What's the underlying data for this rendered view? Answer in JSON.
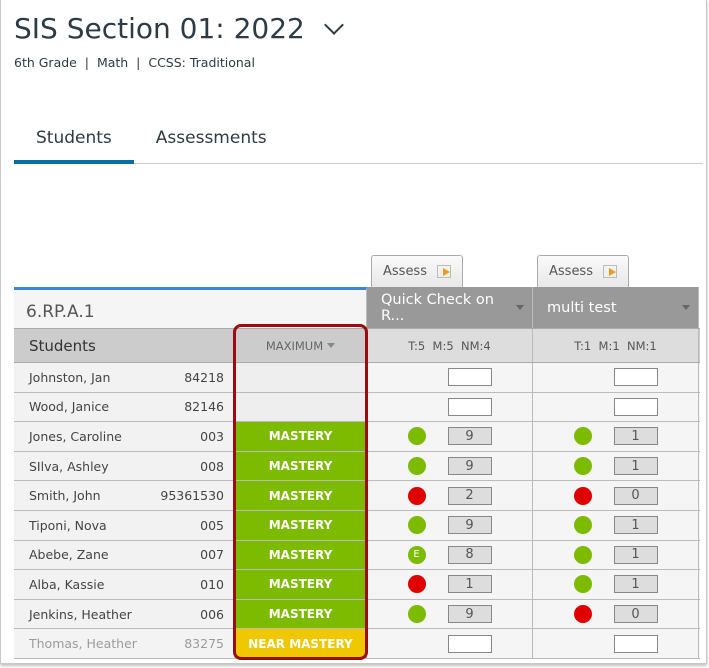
{
  "header": {
    "title": "SIS Section 01: 2022",
    "subtitle": "6th Grade  |  Math  |  CCSS: Traditional"
  },
  "tabs": [
    {
      "label": "Students",
      "active": true
    },
    {
      "label": "Assessments",
      "active": false
    }
  ],
  "standard": "6.RP.A.1",
  "assess_label": "Assess",
  "columns": {
    "students": "Students",
    "calc": "MAXIMUM",
    "assessments": [
      {
        "name": "Quick Check on R...",
        "stats": "T:5  M:5  NM:4"
      },
      {
        "name": "multi test",
        "stats": "T:1  M:1  NM:1"
      }
    ]
  },
  "colors": {
    "mastery": "#7cbb00",
    "near_mastery": "#f0c800",
    "green": "#7cbb00",
    "red": "#e00000"
  },
  "rows": [
    {
      "name": "Johnston, Jan",
      "id": "84218",
      "mastery": "",
      "a1": {
        "dot": "",
        "score": ""
      },
      "a2": {
        "dot": "",
        "score": ""
      }
    },
    {
      "name": "Wood, Janice",
      "id": "82146",
      "mastery": "",
      "a1": {
        "dot": "",
        "score": ""
      },
      "a2": {
        "dot": "",
        "score": ""
      }
    },
    {
      "name": "Jones, Caroline",
      "id": "003",
      "mastery": "MASTERY",
      "a1": {
        "dot": "green",
        "score": "9"
      },
      "a2": {
        "dot": "green",
        "score": "1"
      }
    },
    {
      "name": "SIlva, Ashley",
      "id": "008",
      "mastery": "MASTERY",
      "a1": {
        "dot": "green",
        "score": "9"
      },
      "a2": {
        "dot": "green",
        "score": "1"
      }
    },
    {
      "name": "Smith, John",
      "id": "95361530",
      "mastery": "MASTERY",
      "a1": {
        "dot": "red",
        "score": "2"
      },
      "a2": {
        "dot": "red",
        "score": "0"
      }
    },
    {
      "name": "Tiponi, Nova",
      "id": "005",
      "mastery": "MASTERY",
      "a1": {
        "dot": "green",
        "score": "9"
      },
      "a2": {
        "dot": "green",
        "score": "1"
      }
    },
    {
      "name": "Abebe, Zane",
      "id": "007",
      "mastery": "MASTERY",
      "a1": {
        "dot": "green",
        "label": "E",
        "score": "8"
      },
      "a2": {
        "dot": "green",
        "score": "1"
      }
    },
    {
      "name": "Alba, Kassie",
      "id": "010",
      "mastery": "MASTERY",
      "a1": {
        "dot": "red",
        "score": "1"
      },
      "a2": {
        "dot": "green",
        "score": "1"
      }
    },
    {
      "name": "Jenkins, Heather",
      "id": "006",
      "mastery": "MASTERY",
      "a1": {
        "dot": "green",
        "score": "9"
      },
      "a2": {
        "dot": "red",
        "score": "0"
      }
    },
    {
      "name": "Thomas, Heather",
      "id": "83275",
      "mastery": "NEAR MASTERY",
      "a1": {
        "dot": "",
        "score": ""
      },
      "a2": {
        "dot": "",
        "score": ""
      }
    }
  ]
}
